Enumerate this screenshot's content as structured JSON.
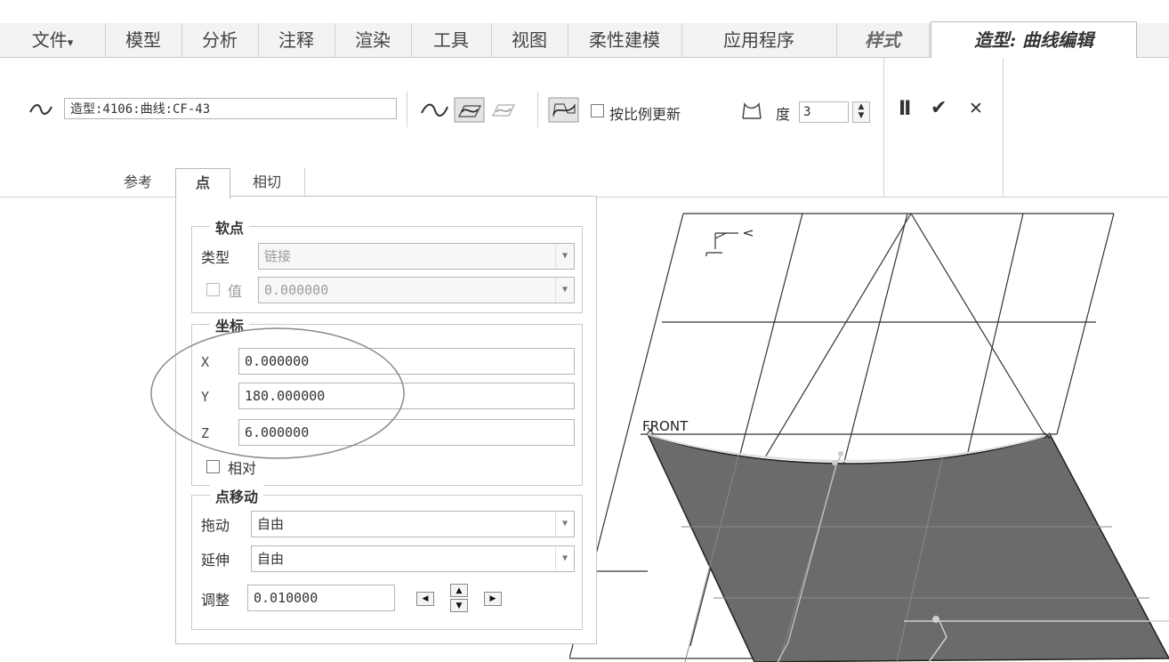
{
  "menu": {
    "tabs": [
      "文件",
      "模型",
      "分析",
      "注释",
      "渲染",
      "工具",
      "视图",
      "柔性建模",
      "应用程序",
      "样式",
      "造型: 曲线编辑"
    ],
    "file_dropdown_glyph": "▾"
  },
  "ribbon": {
    "curve_name": "造型:4106:曲线:CF-43",
    "proportional_update_label": "按比例更新",
    "degree_label": "度",
    "degree_value": "3",
    "pause_label": "II",
    "ok_label": "✔",
    "cancel_label": "✕",
    "icons": [
      "curve-icon",
      "free-curve-icon",
      "planar-curve-icon",
      "cos-curve-icon",
      "control-polygon-icon",
      "curvature-comb-icon"
    ]
  },
  "subtabs": [
    "参考",
    "点",
    "相切"
  ],
  "panel": {
    "soft_point": {
      "title": "软点",
      "type_label": "类型",
      "type_value": "链接",
      "value_label": "值",
      "value_value": "0.000000"
    },
    "coordinates": {
      "title": "坐标",
      "x_label": "X",
      "x_value": "0.000000",
      "y_label": "Y",
      "y_value": "180.000000",
      "z_label": "Z",
      "z_value": "6.000000",
      "relative_label": "相对"
    },
    "point_move": {
      "title": "点移动",
      "drag_label": "拖动",
      "drag_value": "自由",
      "extend_label": "延伸",
      "extend_value": "自由",
      "adjust_label": "调整",
      "adjust_value": "0.010000"
    }
  },
  "viewport": {
    "datum_plane_label": "FRONT",
    "surface_color": "#6b6b6b",
    "grid_color": "#333333"
  }
}
